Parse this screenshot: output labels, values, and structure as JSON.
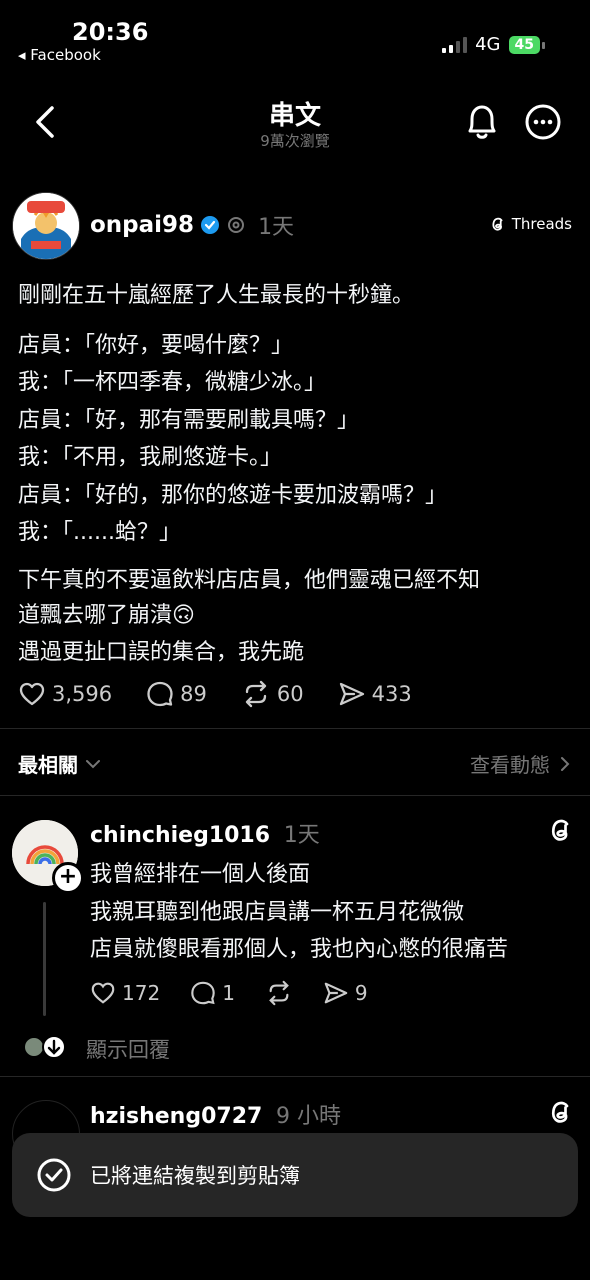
{
  "status": {
    "time": "20:36",
    "back_app": "◂ Facebook",
    "network": "4G",
    "battery": "45"
  },
  "nav": {
    "title": "串文",
    "subtitle": "9萬次瀏覽"
  },
  "post": {
    "username": "onpai98",
    "time": "1天",
    "badge": "Threads",
    "lines": [
      "剛剛在五十嵐經歷了人生最長的十秒鐘。",
      "店員：「你好，要喝什麼？」",
      "我：「一杯四季春，微糖少冰。」",
      "店員：「好，那有需要刷載具嗎？」",
      "我：「不用，我刷悠遊卡。」",
      "店員：「好的，那你的悠遊卡要加波霸嗎？」",
      "我：「......蛤？」",
      "下午真的不要逼飲料店店員，他們靈魂已經不知",
      "道飄去哪了崩潰🙃",
      "遇過更扯口誤的集合，我先跪"
    ],
    "likes": "3,596",
    "comments": "89",
    "reposts": "60",
    "shares": "433"
  },
  "section": {
    "sort_label": "最相關",
    "activity_label": "查看動態"
  },
  "replies": [
    {
      "username": "chinchieg1016",
      "time": "1天",
      "lines": [
        "我曾經排在一個人後面",
        "我親耳聽到他跟店員講一杯五月花微微",
        "店員就傻眼看那個人，我也內心憋的很痛苦"
      ],
      "likes": "172",
      "comments": "1",
      "reposts": "",
      "shares": "9"
    },
    {
      "username": "hzisheng0727",
      "time": "9 小時"
    }
  ],
  "show_replies": "顯示回覆",
  "toast": "已將連結複製到剪貼簿"
}
